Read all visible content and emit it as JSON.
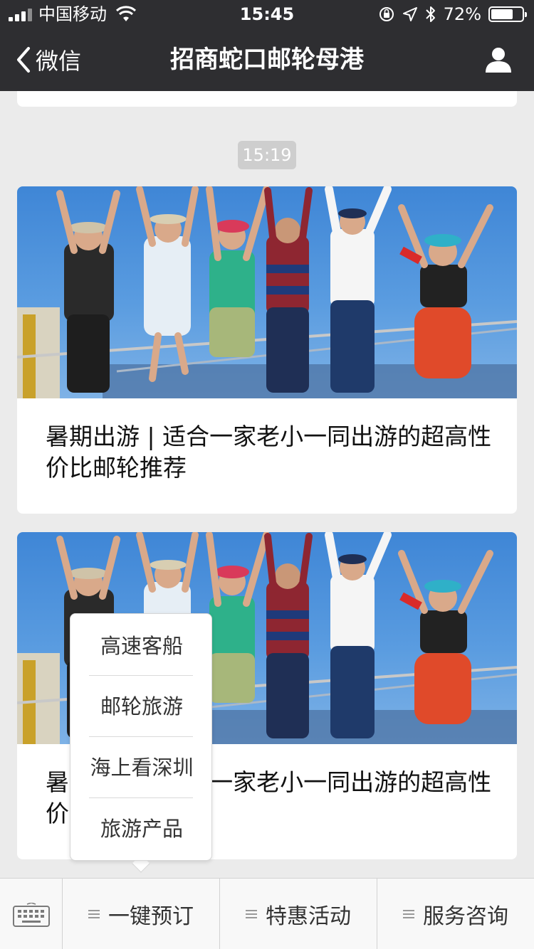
{
  "status_bar": {
    "carrier": "中国移动",
    "time": "15:45",
    "battery_percent": "72%",
    "battery_level": 0.72
  },
  "nav": {
    "back_label": "微信",
    "title": "招商蛇口邮轮母港"
  },
  "chat": {
    "timestamp": "15:19"
  },
  "articles": [
    {
      "title": "暑期出游 | 适合一家老小一同出游的超高性价比邮轮推荐"
    },
    {
      "title": "暑期出游 | 适合一家老小一同出游的超高性价比邮轮推荐"
    }
  ],
  "popup_menu": {
    "items": [
      "高速客船",
      "邮轮旅游",
      "海上看深圳",
      "旅游产品"
    ]
  },
  "bottom_menu": {
    "items": [
      "一键预订",
      "特惠活动",
      "服务咨询"
    ]
  },
  "colors": {
    "nav_background": "#2e2e31",
    "page_background": "#ebebeb",
    "timestamp_chip": "#cecece"
  }
}
